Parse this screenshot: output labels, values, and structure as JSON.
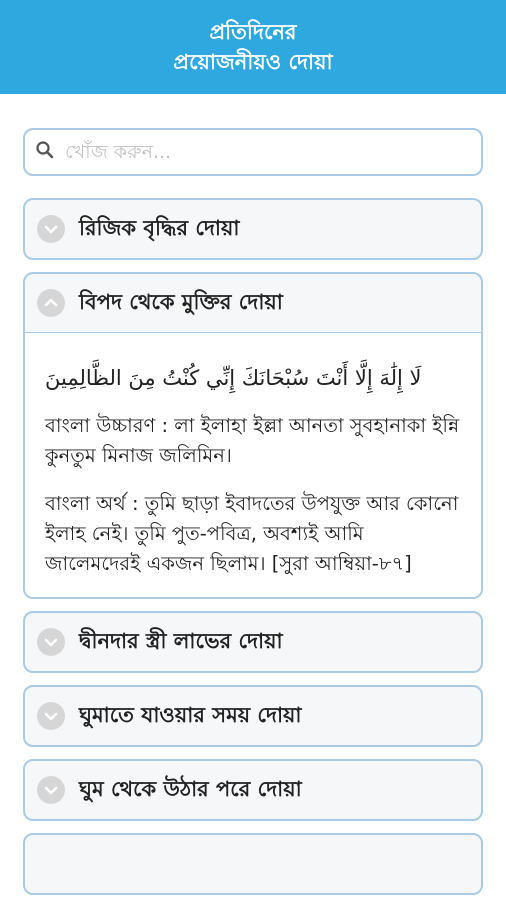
{
  "header": {
    "title_line1": "প্রতিদিনের",
    "title_line2": "প্রয়োজনীয়ও দোয়া"
  },
  "search": {
    "placeholder": "খোঁজ করুন..."
  },
  "items": [
    {
      "title": "রিজিক বৃদ্ধির দোয়া",
      "expanded": false
    },
    {
      "title": "বিপদ থেকে মুক্তির দোয়া",
      "expanded": true,
      "arabic": "لَا إِلَٰهَ إِلَّا أَنْتَ سُبْحَانَكَ إِنِّي كُنْتُ مِنَ الظَّالِمِينَ",
      "pronunciation": "বাংলা উচ্চারণ : লা ইলাহা ইল্লা আনতা সুবহানাকা ইন্নি কুনতুম মিনাজ জলিমিন।",
      "meaning": "বাংলা অর্থ : তুমি ছাড়া ইবাদতের উপযুক্ত আর কোনো ইলাহ নেই। তুমি পুত-পবিত্র, অবশ্যই আমি জালেমদেরই একজন ছিলাম। [সুরা আম্বিয়া-৮৭]"
    },
    {
      "title": "দ্বীনদার স্ত্রী লাভের দোয়া",
      "expanded": false
    },
    {
      "title": "ঘুমাতে যাওয়ার সময় দোয়া",
      "expanded": false
    },
    {
      "title": "ঘুম থেকে উঠার পরে দোয়া",
      "expanded": false
    }
  ],
  "colors": {
    "header_bg": "#2ea8de",
    "border": "#a9cbe6",
    "item_bg": "#f6f7f9",
    "chevron_bg": "#d6d6d6"
  },
  "icons": {
    "search": "search-icon",
    "collapsed": "chevron-down-icon",
    "expanded": "chevron-up-icon"
  }
}
